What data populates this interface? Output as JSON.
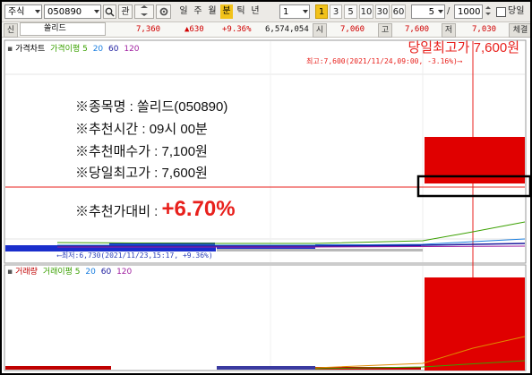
{
  "toolbar": {
    "market_select": "주식",
    "code_input": "050890",
    "search_icon": "search-icon",
    "ref_label": "관",
    "periods": [
      "일",
      "주",
      "월",
      "분",
      "틱",
      "년"
    ],
    "active_period": "분",
    "count_select": "1",
    "intervals": [
      "1",
      "3",
      "5",
      "10",
      "30",
      "60"
    ],
    "active_interval": "1",
    "spin_value": "5",
    "ratio_value": "1000",
    "today_label": "당일"
  },
  "quote": {
    "badge": "신",
    "name": "쏠리드",
    "price": "7,360",
    "change": "▲630",
    "rate": "+9.36%",
    "volume": "6,574,054",
    "open_label": "시",
    "open": "7,060",
    "high_label": "고",
    "high": "7,600",
    "low_label": "저",
    "low": "7,030",
    "close_label": "체결"
  },
  "price_pane": {
    "legend": [
      {
        "label": "가격차트",
        "color": "#c00000"
      },
      {
        "label": "가격이평 5",
        "color": "#3aa000"
      },
      {
        "label": "20",
        "color": "#1b7fe0"
      },
      {
        "label": "60",
        "color": "#1a1a9e"
      },
      {
        "label": "120",
        "color": "#a020a0"
      }
    ],
    "headline": "당일최고가 7,600원",
    "high_annotation": "최고:7,600(2021/11/24,09:00, -3.16%)⟶",
    "low_annotation": "⟵최저:6,730(2021/11/23,15:17, +9.36%)"
  },
  "volume_pane": {
    "legend": [
      {
        "label": "거래량",
        "color": "#c00000"
      },
      {
        "label": "거래이평 5",
        "color": "#3aa000"
      },
      {
        "label": "20",
        "color": "#1b7fe0"
      },
      {
        "label": "60",
        "color": "#1a1a9e"
      },
      {
        "label": "120",
        "color": "#a020a0"
      }
    ]
  },
  "info": {
    "stock_name": "※종목명 : 쏠리드(050890)",
    "rec_time": "※추천시간 : 09시 00분",
    "rec_price": "※추천매수가 : 7,100원",
    "day_high": "※당일최고가 : 7,600원",
    "rate_label": "※추천가대비 : ",
    "rate_value": "+6.70%"
  },
  "colors": {
    "accent_red": "#e8201c",
    "candle_red": "#e00000",
    "candle_blue": "#1a2ecc",
    "highlight_yellow": "#f2c21a"
  }
}
